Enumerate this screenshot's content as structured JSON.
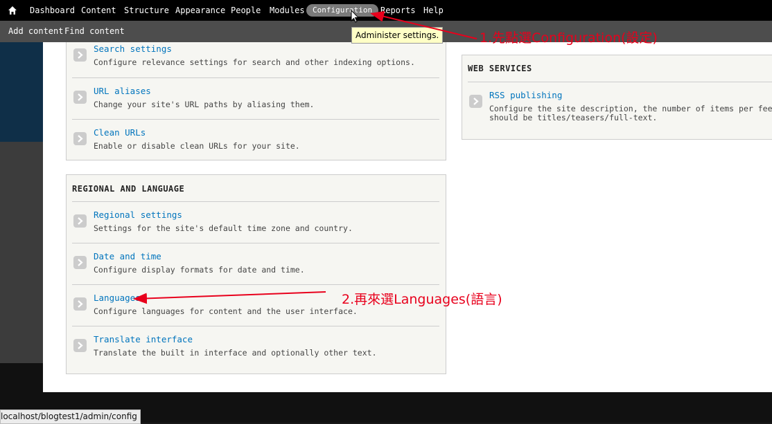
{
  "toolbar": {
    "items": [
      {
        "label": "Dashboard"
      },
      {
        "label": "Content"
      },
      {
        "label": "Structure"
      },
      {
        "label": "Appearance"
      },
      {
        "label": "People"
      },
      {
        "label": "Modules"
      },
      {
        "label": "Configuration",
        "active": true
      },
      {
        "label": "Reports"
      },
      {
        "label": "Help"
      }
    ]
  },
  "shortcuts": {
    "add_content": "Add content",
    "find_content": "Find content"
  },
  "tooltip": "Administer settings.",
  "search_panel": {
    "items": [
      {
        "label": "Search settings",
        "desc": "Configure relevance settings for search and other indexing options."
      },
      {
        "label": "URL aliases",
        "desc": "Change your site's URL paths by aliasing them."
      },
      {
        "label": "Clean URLs",
        "desc": "Enable or disable clean URLs for your site."
      }
    ]
  },
  "regional_panel": {
    "title": "REGIONAL AND LANGUAGE",
    "items": [
      {
        "label": "Regional settings",
        "desc": "Settings for the site's default time zone and country."
      },
      {
        "label": "Date and time",
        "desc": "Configure display formats for date and time."
      },
      {
        "label": "Languages",
        "desc": "Configure languages for content and the user interface."
      },
      {
        "label": "Translate interface",
        "desc": "Translate the built in interface and optionally other text."
      }
    ]
  },
  "web_services_panel": {
    "title": "WEB SERVICES",
    "items": [
      {
        "label": "RSS publishing",
        "desc": "Configure the site description, the number of items per feed and whether feeds",
        "desc2": "should be titles/teasers/full-text."
      }
    ]
  },
  "annotations": {
    "step1": "1.先點選Configuration(設定)",
    "step2": "2.再來選Languages(語言)"
  },
  "colors": {
    "annotation": "#e8001c",
    "link": "#0074bd",
    "toolbar": "#000000",
    "active_tab": "#7a7a7a"
  },
  "statusbar": "localhost/blogtest1/admin/config"
}
